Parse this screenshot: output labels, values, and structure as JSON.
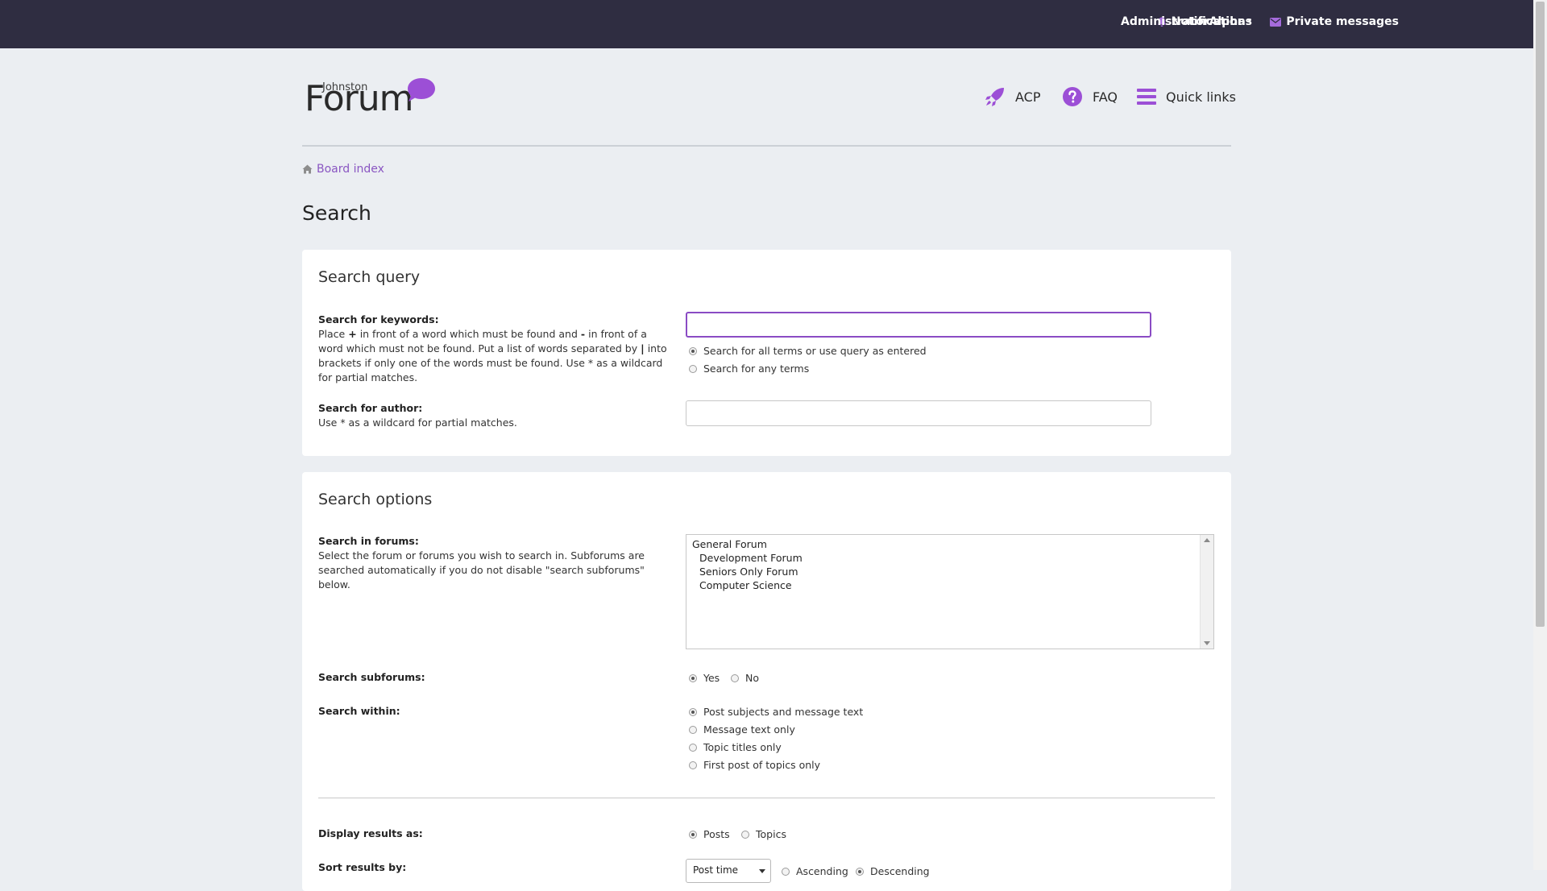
{
  "topbar": {
    "notifications": "Notifications",
    "private_messages": "Private messages",
    "username": "AdministratorAlpha",
    "caret": "▾"
  },
  "logo": {
    "small_text": "Johnston",
    "big_text": "Forum"
  },
  "header_links": {
    "acp": "ACP",
    "faq": "FAQ",
    "quick_links": "Quick links"
  },
  "breadcrumb": {
    "board_index": "Board index"
  },
  "page": {
    "title": "Search"
  },
  "search_query": {
    "heading": "Search query",
    "keywords_label": "Search for keywords:",
    "keywords_desc_1": "Place",
    "keywords_desc_plus": "+",
    "keywords_desc_2": "in front of a word which must be found and",
    "keywords_desc_minus": "-",
    "keywords_desc_3": "in front of a word which must not be found. Put a list of words separated by",
    "keywords_desc_pipe": "|",
    "keywords_desc_4": "into brackets if only one of the words must be found. Use * as a wildcard for partial matches.",
    "keywords_value": "",
    "terms_all": "Search for all terms or use query as entered",
    "terms_any": "Search for any terms",
    "author_label": "Search for author:",
    "author_desc": "Use * as a wildcard for partial matches.",
    "author_value": ""
  },
  "search_options": {
    "heading": "Search options",
    "forums_label": "Search in forums:",
    "forums_desc": "Select the forum or forums you wish to search in. Subforums are searched automatically if you do not disable \"search subforums\" below.",
    "forums": [
      {
        "name": "General Forum"
      },
      {
        "name": "Development Forum"
      },
      {
        "name": "Seniors Only Forum"
      },
      {
        "name": "Computer Science"
      }
    ],
    "subforums_label": "Search subforums:",
    "subforums_yes": "Yes",
    "subforums_no": "No",
    "within_label": "Search within:",
    "within_options": [
      "Post subjects and message text",
      "Message text only",
      "Topic titles only",
      "First post of topics only"
    ],
    "display_label": "Display results as:",
    "display_posts": "Posts",
    "display_topics": "Topics",
    "sort_label": "Sort results by:",
    "sort_selected": "Post time",
    "sort_ascending": "Ascending",
    "sort_descending": "Descending"
  },
  "colors": {
    "accent": "#8a4bc4",
    "topbar": "#2f2d41",
    "background": "#ebeef2"
  }
}
